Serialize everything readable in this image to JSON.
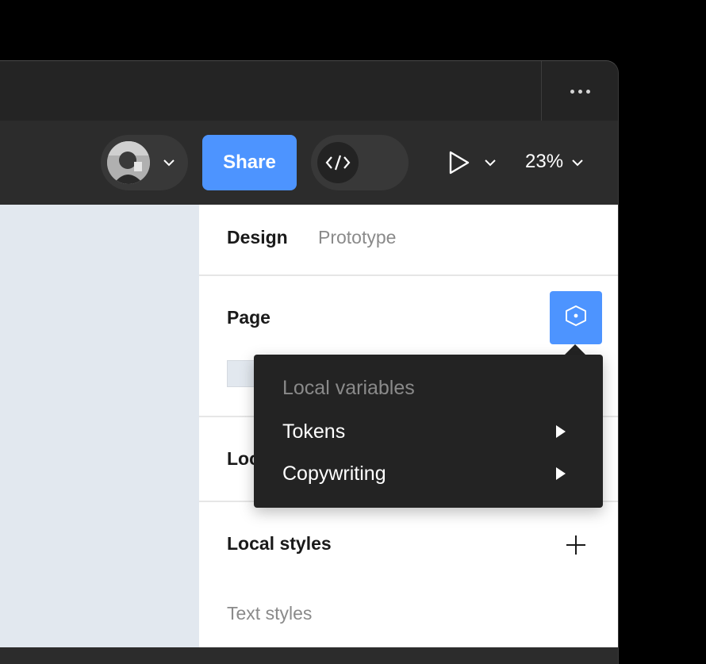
{
  "toolbar": {
    "share_label": "Share",
    "zoom_label": "23%"
  },
  "icons": {
    "more": "more-horizontal-icon",
    "code": "code-icon",
    "play": "play-icon",
    "chevron": "chevron-down-icon",
    "variables": "variables-icon",
    "add": "plus-icon",
    "submenu": "triangle-right-icon"
  },
  "panel": {
    "tabs": [
      {
        "label": "Design",
        "active": true
      },
      {
        "label": "Prototype",
        "active": false
      }
    ],
    "page_title": "Page",
    "local_partial_label": "Loc",
    "local_styles_title": "Local styles",
    "text_styles_label": "Text styles"
  },
  "variables_menu": {
    "header": "Local variables",
    "items": [
      {
        "label": "Tokens"
      },
      {
        "label": "Copywriting"
      }
    ]
  },
  "colors": {
    "accent": "#4d94ff",
    "toolbar": "#2c2c2c",
    "canvas": "#e2e8ef",
    "menu": "#232323"
  }
}
